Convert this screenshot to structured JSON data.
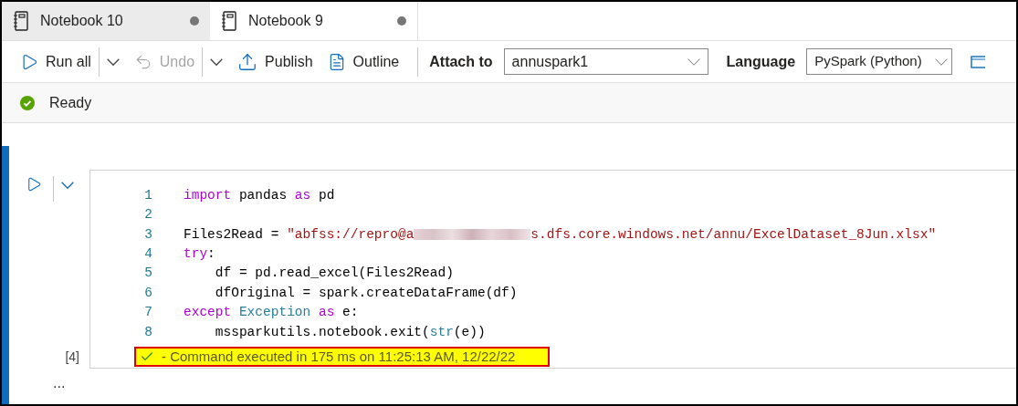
{
  "tabs": [
    {
      "label": "Notebook 10",
      "selected": false,
      "unsaved": true
    },
    {
      "label": "Notebook 9",
      "selected": true,
      "unsaved": true
    }
  ],
  "toolbar": {
    "items": [
      {
        "kind": "run",
        "label": "Run all",
        "disabled": false
      },
      {
        "kind": "caret",
        "disabled": false
      },
      {
        "kind": "undo",
        "label": "Undo",
        "disabled": true
      },
      {
        "kind": "caret",
        "disabled": false
      },
      {
        "kind": "publish",
        "label": "Publish",
        "disabled": false
      },
      {
        "kind": "outline",
        "label": "Outline",
        "disabled": false
      }
    ],
    "attach": {
      "label": "Attach to",
      "value": "annuspark1"
    },
    "language": {
      "label": "Language",
      "value": "PySpark (Python)"
    }
  },
  "status": {
    "kind": "ok",
    "text": "Ready"
  },
  "cell": {
    "execution_count": "[4]",
    "lines": [
      {
        "number": "1",
        "tokens": [
          {
            "kind": "keyword",
            "text": "import"
          },
          {
            "kind": "plain",
            "text": " pandas "
          },
          {
            "kind": "keyword",
            "text": "as"
          },
          {
            "kind": "plain",
            "text": " pd"
          }
        ]
      },
      {
        "number": "2"
      },
      {
        "number": "3",
        "tokens": [
          {
            "kind": "plain",
            "text": "Files2Read = "
          },
          {
            "kind": "string",
            "text": "\"abfss://repro@a"
          },
          {
            "kind": "redacted"
          },
          {
            "kind": "string",
            "text": "s.dfs.core.windows.net/annu/ExcelDataset_8Jun.xlsx\""
          }
        ]
      },
      {
        "number": "4",
        "tokens": [
          {
            "kind": "keyword",
            "text": "try"
          },
          {
            "kind": "plain",
            "text": ":"
          }
        ]
      },
      {
        "number": "5",
        "tokens": [
          {
            "kind": "plain",
            "text": "    df = pd.read_excel(Files2Read)"
          }
        ]
      },
      {
        "number": "6",
        "tokens": [
          {
            "kind": "plain",
            "text": "    dfOriginal = spark.createDataFrame(df)"
          }
        ]
      },
      {
        "number": "7",
        "tokens": [
          {
            "kind": "keyword",
            "text": "except"
          },
          {
            "kind": "type",
            "text": " Exception"
          },
          {
            "kind": "keyword",
            "text": " as"
          },
          {
            "kind": "plain",
            "text": " e:"
          }
        ]
      },
      {
        "number": "8",
        "tokens": [
          {
            "kind": "plain",
            "text": "    mssparkutils.notebook.exit("
          },
          {
            "kind": "builtin",
            "text": "str"
          },
          {
            "kind": "plain",
            "text": "(e))"
          }
        ]
      }
    ],
    "result": {
      "kind": "success",
      "text": "- Command executed in 175 ms on 11:25:13 AM, 12/22/22",
      "highlighted": true
    }
  },
  "more": "..."
}
